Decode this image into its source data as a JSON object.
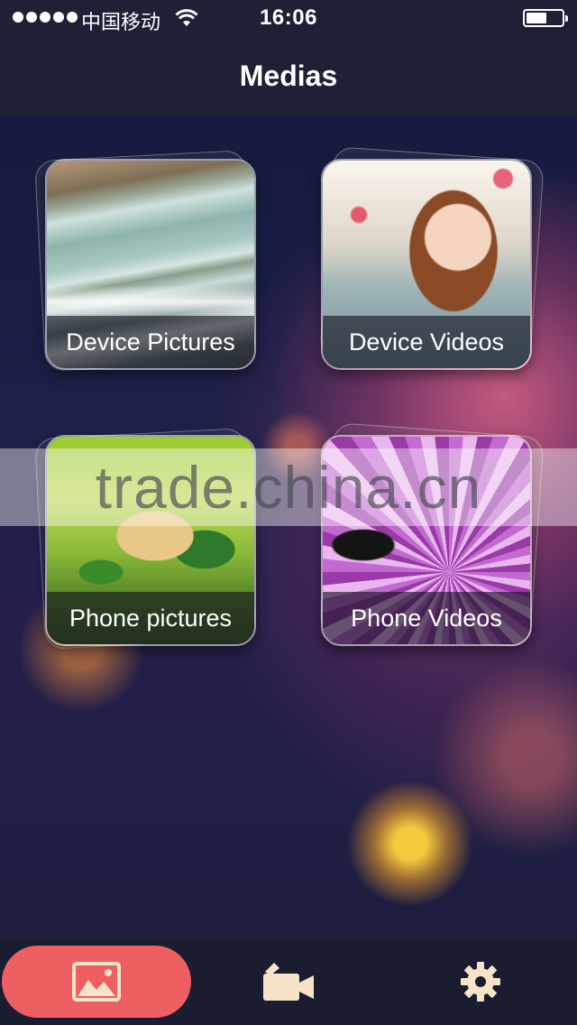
{
  "status_bar": {
    "carrier": "中国移动",
    "time": "16:06"
  },
  "nav": {
    "title": "Medias"
  },
  "tiles": [
    {
      "label": "Device Pictures",
      "image": "waterfall-photo"
    },
    {
      "label": "Device Videos",
      "image": "girl-photo"
    },
    {
      "label": "Phone pictures",
      "image": "bird-photo"
    },
    {
      "label": "Phone Videos",
      "image": "flower-photo"
    }
  ],
  "watermark": "trade.china.cn",
  "tab_bar": {
    "tabs": [
      {
        "icon": "image-icon",
        "selected": true
      },
      {
        "icon": "video-camera-icon",
        "selected": false
      },
      {
        "icon": "gear-icon",
        "selected": false
      }
    ]
  },
  "colors": {
    "accent": "#ee5f62",
    "bar_background": "#1e2136",
    "icon_tint": "#f7e3c8"
  }
}
